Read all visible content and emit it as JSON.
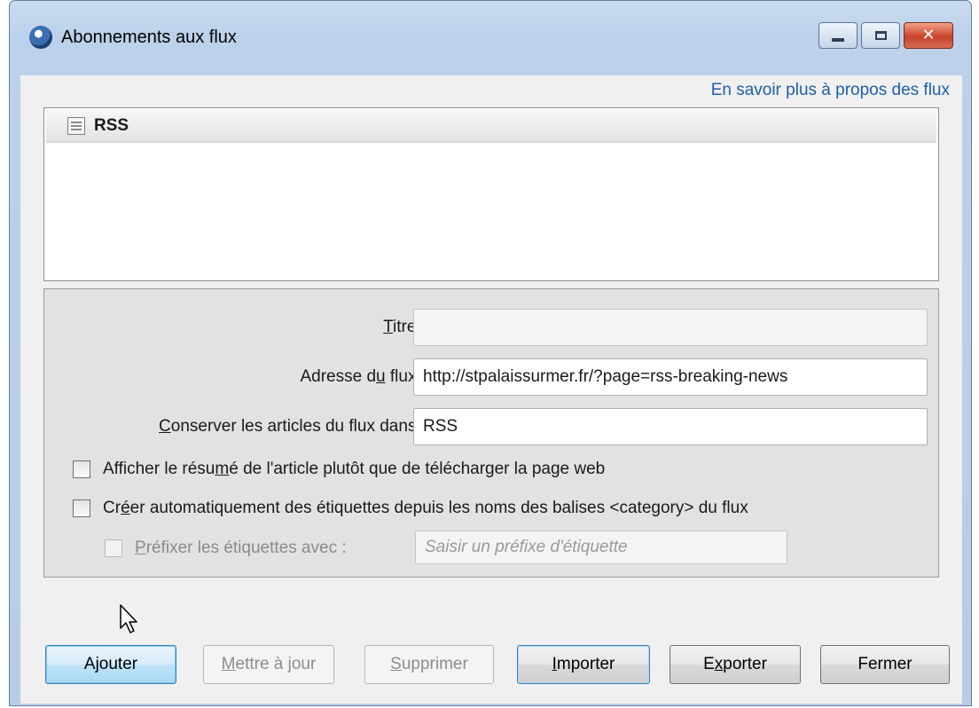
{
  "window": {
    "title": "Abonnements aux flux",
    "icon": "thunderbird-icon",
    "controls": {
      "minimize": "minimize-icon",
      "maximize": "maximize-icon",
      "close": "✕"
    }
  },
  "learn_more_link": "En savoir plus à propos des flux",
  "tree": {
    "items": [
      {
        "label": "RSS",
        "icon": "feed-folder-icon"
      }
    ]
  },
  "form": {
    "title": {
      "label_pre": "",
      "label_mnemonic": "T",
      "label_post": "itre :",
      "value": ""
    },
    "address": {
      "label_pre": "Adresse d",
      "label_mnemonic": "u",
      "label_post": " flux :",
      "value": "http://stpalaissurmer.fr/?page=rss-breaking-news"
    },
    "folder": {
      "label_pre": "",
      "label_mnemonic": "C",
      "label_post": "onserver les articles du flux dans :",
      "value": "RSS"
    },
    "summary_checkbox": {
      "label_pre": "Afficher le résu",
      "label_mnemonic": "m",
      "label_post": "é de l'article plutôt que de télécharger la page web",
      "checked": false
    },
    "autotag_checkbox": {
      "label_pre": "Cr",
      "label_mnemonic": "é",
      "label_post": "er automatiquement des étiquettes depuis les noms des balises <category> du flux",
      "checked": false
    },
    "prefix_checkbox": {
      "label_pre": "",
      "label_mnemonic": "P",
      "label_post": "réfixer les étiquettes avec :",
      "checked": false,
      "disabled": true
    },
    "prefix_input": {
      "placeholder": "Saisir un préfixe d'étiquette",
      "value": ""
    }
  },
  "buttons": {
    "add": {
      "pre": "A",
      "mnemonic": "j",
      "post": "outer"
    },
    "update": {
      "pre": "",
      "mnemonic": "M",
      "post": "ettre à jour"
    },
    "remove": {
      "pre": "",
      "mnemonic": "S",
      "post": "upprimer"
    },
    "import": {
      "pre": "",
      "mnemonic": "I",
      "post": "mporter"
    },
    "export": {
      "pre": "E",
      "mnemonic": "x",
      "post": "porter"
    },
    "close": {
      "pre": "",
      "mnemonic": "",
      "post": "Fermer"
    }
  }
}
